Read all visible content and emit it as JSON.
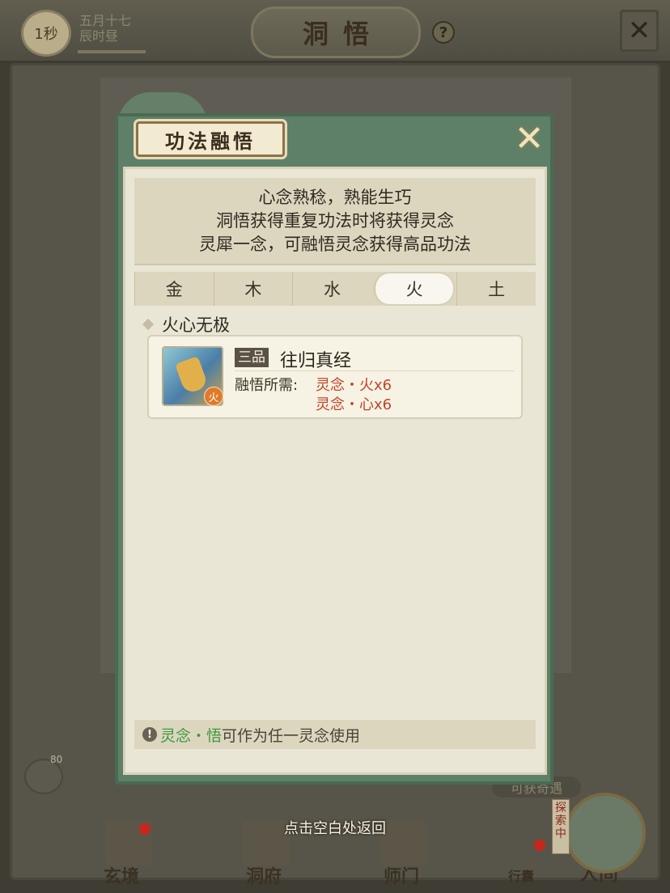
{
  "topbar": {
    "timer": "1秒",
    "date_line1": "五月十七",
    "date_line2": "辰时昼",
    "title": "洞悟",
    "help": "?"
  },
  "dialog": {
    "title": "功法融悟",
    "intro": [
      "心念熟稔，熟能生巧",
      "洞悟获得重复功法时将获得灵念",
      "灵犀一念，可融悟灵念获得高品功法"
    ],
    "tabs": [
      {
        "label": "金",
        "active": false
      },
      {
        "label": "木",
        "active": false
      },
      {
        "label": "水",
        "active": false
      },
      {
        "label": "火",
        "active": true
      },
      {
        "label": "土",
        "active": false
      }
    ],
    "group_title": "火心无极",
    "item": {
      "grade": "三品",
      "name": "往归真经",
      "element_badge": "火",
      "requirement_label": "融悟所需:",
      "requirements": [
        "灵念・火x6",
        "灵念・心x6"
      ]
    },
    "footer": {
      "highlight": "灵念・悟",
      "text": "可作为任一灵念使用"
    }
  },
  "background": {
    "chat_count": "80",
    "reward_tag": "可获奇遇",
    "explore_tag": "探索中",
    "return_hint": "点击空白处返回",
    "nav": [
      "玄境",
      "洞府",
      "师门",
      "行囊",
      "人间"
    ]
  },
  "colors": {
    "dialog_frame": "#5e8068",
    "requirement_red": "#c0452a",
    "highlight_green": "#3a9a3e"
  }
}
